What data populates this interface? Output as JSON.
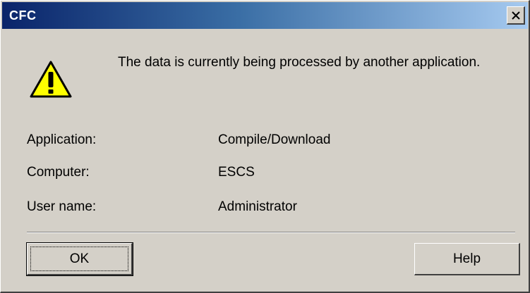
{
  "window": {
    "title": "CFC",
    "close_icon": "close-icon"
  },
  "message": {
    "icon": "warning-icon",
    "text": "The data is currently being processed by another application."
  },
  "details": [
    {
      "label": "Application:",
      "value": "Compile/Download"
    },
    {
      "label": "Computer:",
      "value": "ESCS"
    },
    {
      "label": "User name:",
      "value": "Administrator"
    }
  ],
  "buttons": {
    "ok_label": "OK",
    "help_label": "Help"
  },
  "colors": {
    "titlebar_start": "#0a246a",
    "titlebar_end": "#a6caf0",
    "dialog_background": "#d4d0c8",
    "warning_fill": "#ffff00"
  }
}
